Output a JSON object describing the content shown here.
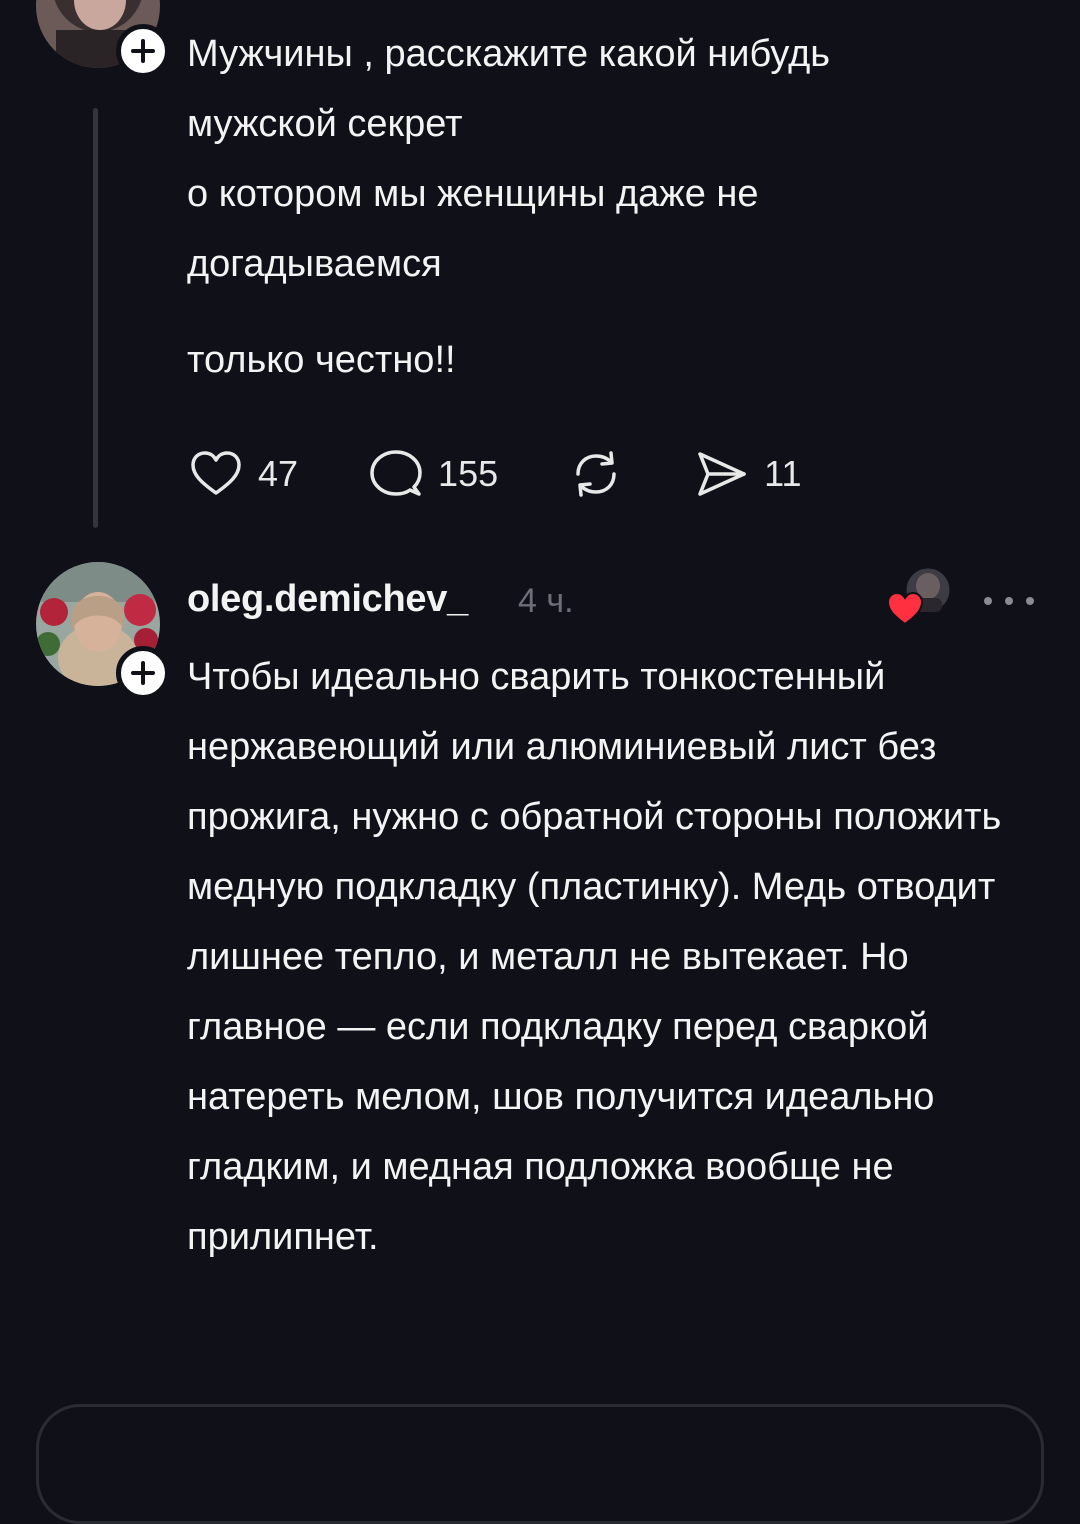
{
  "post": {
    "text": "Мужчины , расскажите какой нибудь\nмужской секрет\nо котором мы женщины  даже не\nдогадываемся",
    "text2": "только честно!!",
    "likes": "47",
    "comments": "155",
    "shares": "11"
  },
  "reply": {
    "username": "oleg.demichev_",
    "time": "4 ч.",
    "text": "Чтобы идеально сварить тонкостенный нержавеющий или алюминиевый лист без прожига, нужно с обратной стороны положить медную подкладку (пластинку). Медь отводит лишнее тепло, и металл не вытекает. Но главное — если подкладку перед сваркой натереть мелом, шов получится идеально гладким, и медная подложка вообще не прилипнет."
  },
  "icons": {
    "like": "heart-icon",
    "comment": "speech-bubble-icon",
    "repost": "repost-arrows-icon",
    "share": "send-paper-plane-icon",
    "follow": "plus-icon",
    "more": "more-dots-icon",
    "liked_by": "heart-badge-icon"
  },
  "colors": {
    "background": "#101118",
    "text": "#f3f3f3",
    "muted": "#6d6f78",
    "heart": "#ff3040"
  }
}
